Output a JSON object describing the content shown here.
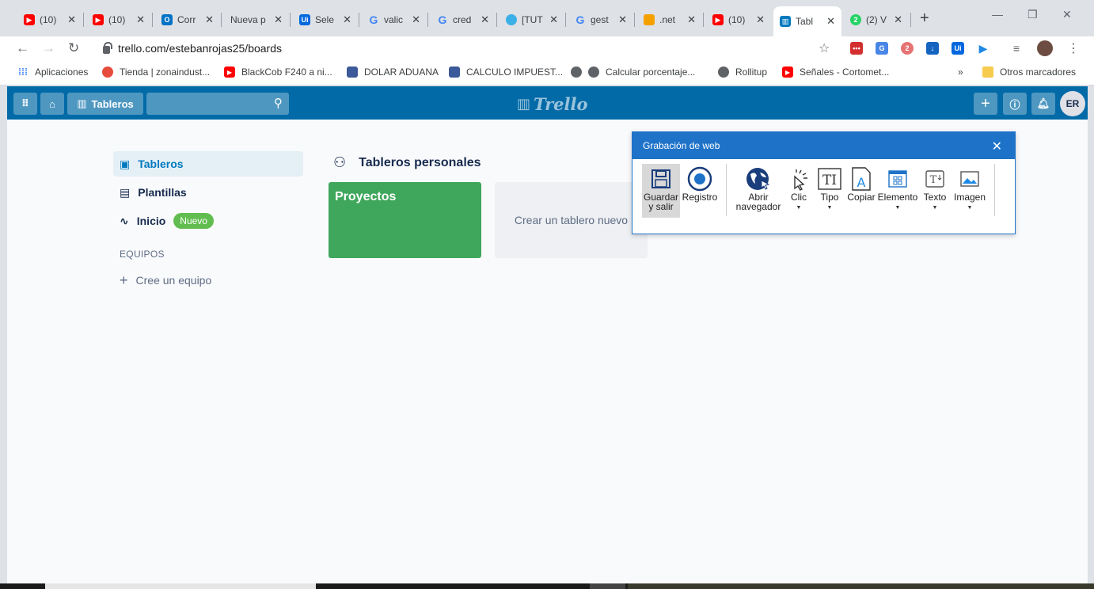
{
  "browser": {
    "tabs": [
      {
        "title": "(10)",
        "icon": "youtube-icon",
        "color": "#ff0000"
      },
      {
        "title": "(10)",
        "icon": "youtube-icon",
        "color": "#ff0000"
      },
      {
        "title": "Corr",
        "icon": "outlook-icon",
        "color": "#0072c6"
      },
      {
        "title": "Nueva p",
        "icon": "",
        "color": ""
      },
      {
        "title": "Sele",
        "icon": "uipath-icon",
        "color": "#0067df"
      },
      {
        "title": "valic",
        "icon": "google-icon",
        "color": "#4285f4"
      },
      {
        "title": "cred",
        "icon": "google-icon",
        "color": "#4285f4"
      },
      {
        "title": "[TUT",
        "icon": "drop-icon",
        "color": "#3bb0e6"
      },
      {
        "title": "gest",
        "icon": "google-icon",
        "color": "#4285f4"
      },
      {
        "title": ".net",
        "icon": "stackoverflow-icon",
        "color": "#f4a100"
      },
      {
        "title": "(10)",
        "icon": "youtube-icon",
        "color": "#ff0000"
      },
      {
        "title": "Tabl",
        "icon": "trello-icon",
        "color": "#0079bf"
      },
      {
        "title": "(2) V",
        "icon": "whatsapp-icon",
        "color": "#25d366"
      }
    ],
    "url": "trello.com/estebanrojas25/boards",
    "bookmarks": [
      {
        "label": "Aplicaciones",
        "color": "#4285f4"
      },
      {
        "label": "Tienda | zonaindust...",
        "color": "#e74c3c"
      },
      {
        "label": "BlackCob F240 a ni...",
        "color": "#ff0000"
      },
      {
        "label": "DOLAR ADUANA",
        "color": "#3c5a99"
      },
      {
        "label": "CALCULO IMPUEST...",
        "color": "#3c5a99"
      },
      {
        "label": "Calcular porcentaje...",
        "color": "#5f6368"
      },
      {
        "label": "Rollitup",
        "color": "#5f6368"
      },
      {
        "label": "Señales - Cortomet...",
        "color": "#ff0000"
      }
    ],
    "other_bookmarks": "Otros marcadores"
  },
  "trello": {
    "header": {
      "boards_button": "Tableros",
      "logo": "Trello",
      "avatar": "ER"
    },
    "sidebar": {
      "items": [
        {
          "label": "Tableros"
        },
        {
          "label": "Plantillas"
        },
        {
          "label": "Inicio",
          "badge": "Nuevo"
        }
      ],
      "teams_header": "EQUIPOS",
      "create_team": "Cree un equipo"
    },
    "section_title": "Tableros personales",
    "boards": [
      {
        "title": "Proyectos",
        "color": "#3fa75c"
      }
    ],
    "create_board": "Crear un tablero nuevo"
  },
  "recorder": {
    "title": "Grabación de web",
    "tools": [
      {
        "label": "Guardar y salir"
      },
      {
        "label": "Registro"
      },
      {
        "label": "Abrir navegador"
      },
      {
        "label": "Clic"
      },
      {
        "label": "Tipo"
      },
      {
        "label": "Copiar"
      },
      {
        "label": "Elemento"
      },
      {
        "label": "Texto"
      },
      {
        "label": "Imagen"
      }
    ]
  }
}
